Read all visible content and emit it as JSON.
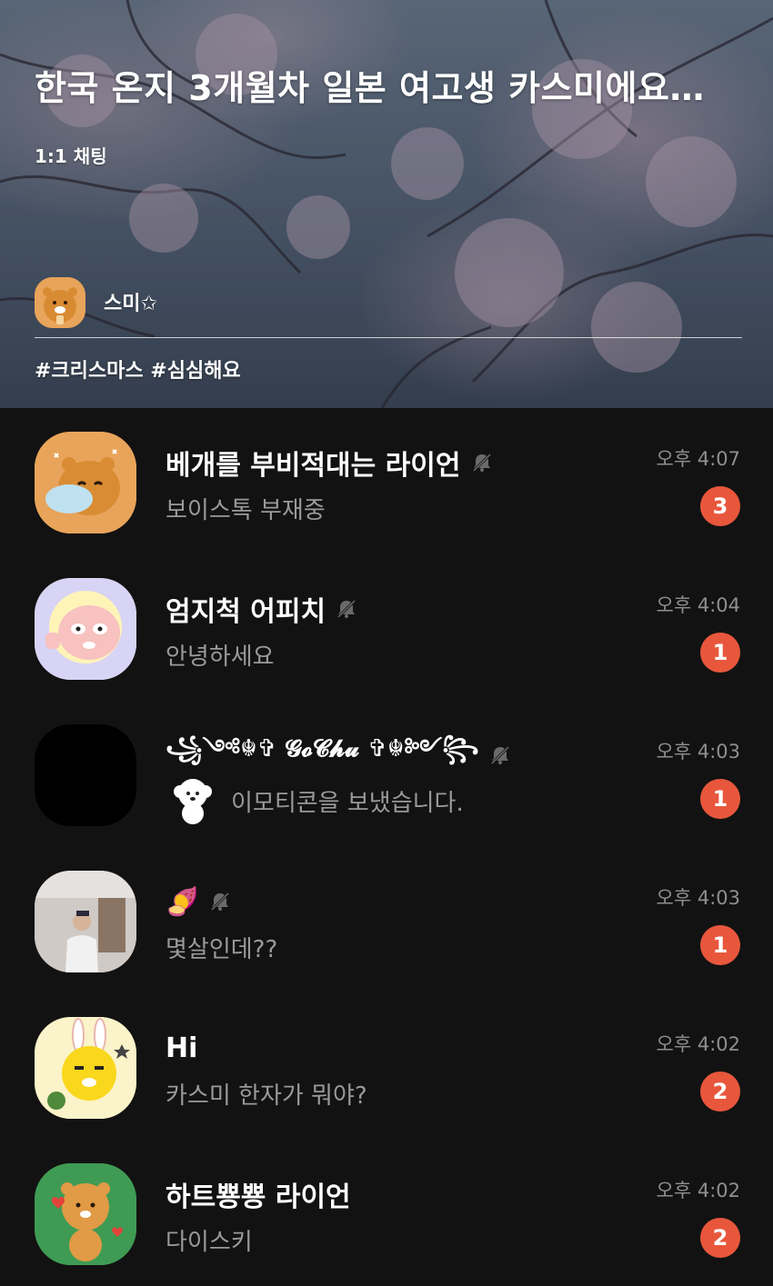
{
  "header": {
    "title": "한국 온지 3개월차 일본 여고생 카스미에요…",
    "subtitle": "1:1 채팅",
    "host_name": "스미✩",
    "tags": "#크리스마스 #심심해요"
  },
  "chats": [
    {
      "name": "베개를 부비적대는 라이언",
      "preview": "보이스톡 부재중",
      "time": "오후 4:07",
      "unread": "3",
      "muted": true,
      "avatar_color": "#e8a45a"
    },
    {
      "name": "엄지척 어피치",
      "preview": "안녕하세요",
      "time": "오후 4:04",
      "unread": "1",
      "muted": true,
      "avatar_color": "#d8d4f5"
    },
    {
      "name": "꧁༺☬✞ 𝓖𝓸𝓒𝓱𝓾 ✞☬༻꧂",
      "preview": "이모티콘을 보냈습니다.",
      "time": "오후 4:03",
      "unread": "1",
      "muted": true,
      "avatar_color": "#000000"
    },
    {
      "name": "🍠",
      "preview": "몇살인데??",
      "time": "오후 4:03",
      "unread": "1",
      "muted": true,
      "avatar_color": "#cfcac6"
    },
    {
      "name": "Hi",
      "preview": "카스미 한자가 뭐야?",
      "time": "오후 4:02",
      "unread": "2",
      "muted": false,
      "avatar_color": "#fbf3c9"
    },
    {
      "name": "하트뿅뿅 라이언",
      "preview": "다이스키",
      "time": "오후 4:02",
      "unread": "2",
      "muted": false,
      "avatar_color": "#3f9b54"
    }
  ],
  "icons": {
    "mute": "bell-slash-icon"
  }
}
